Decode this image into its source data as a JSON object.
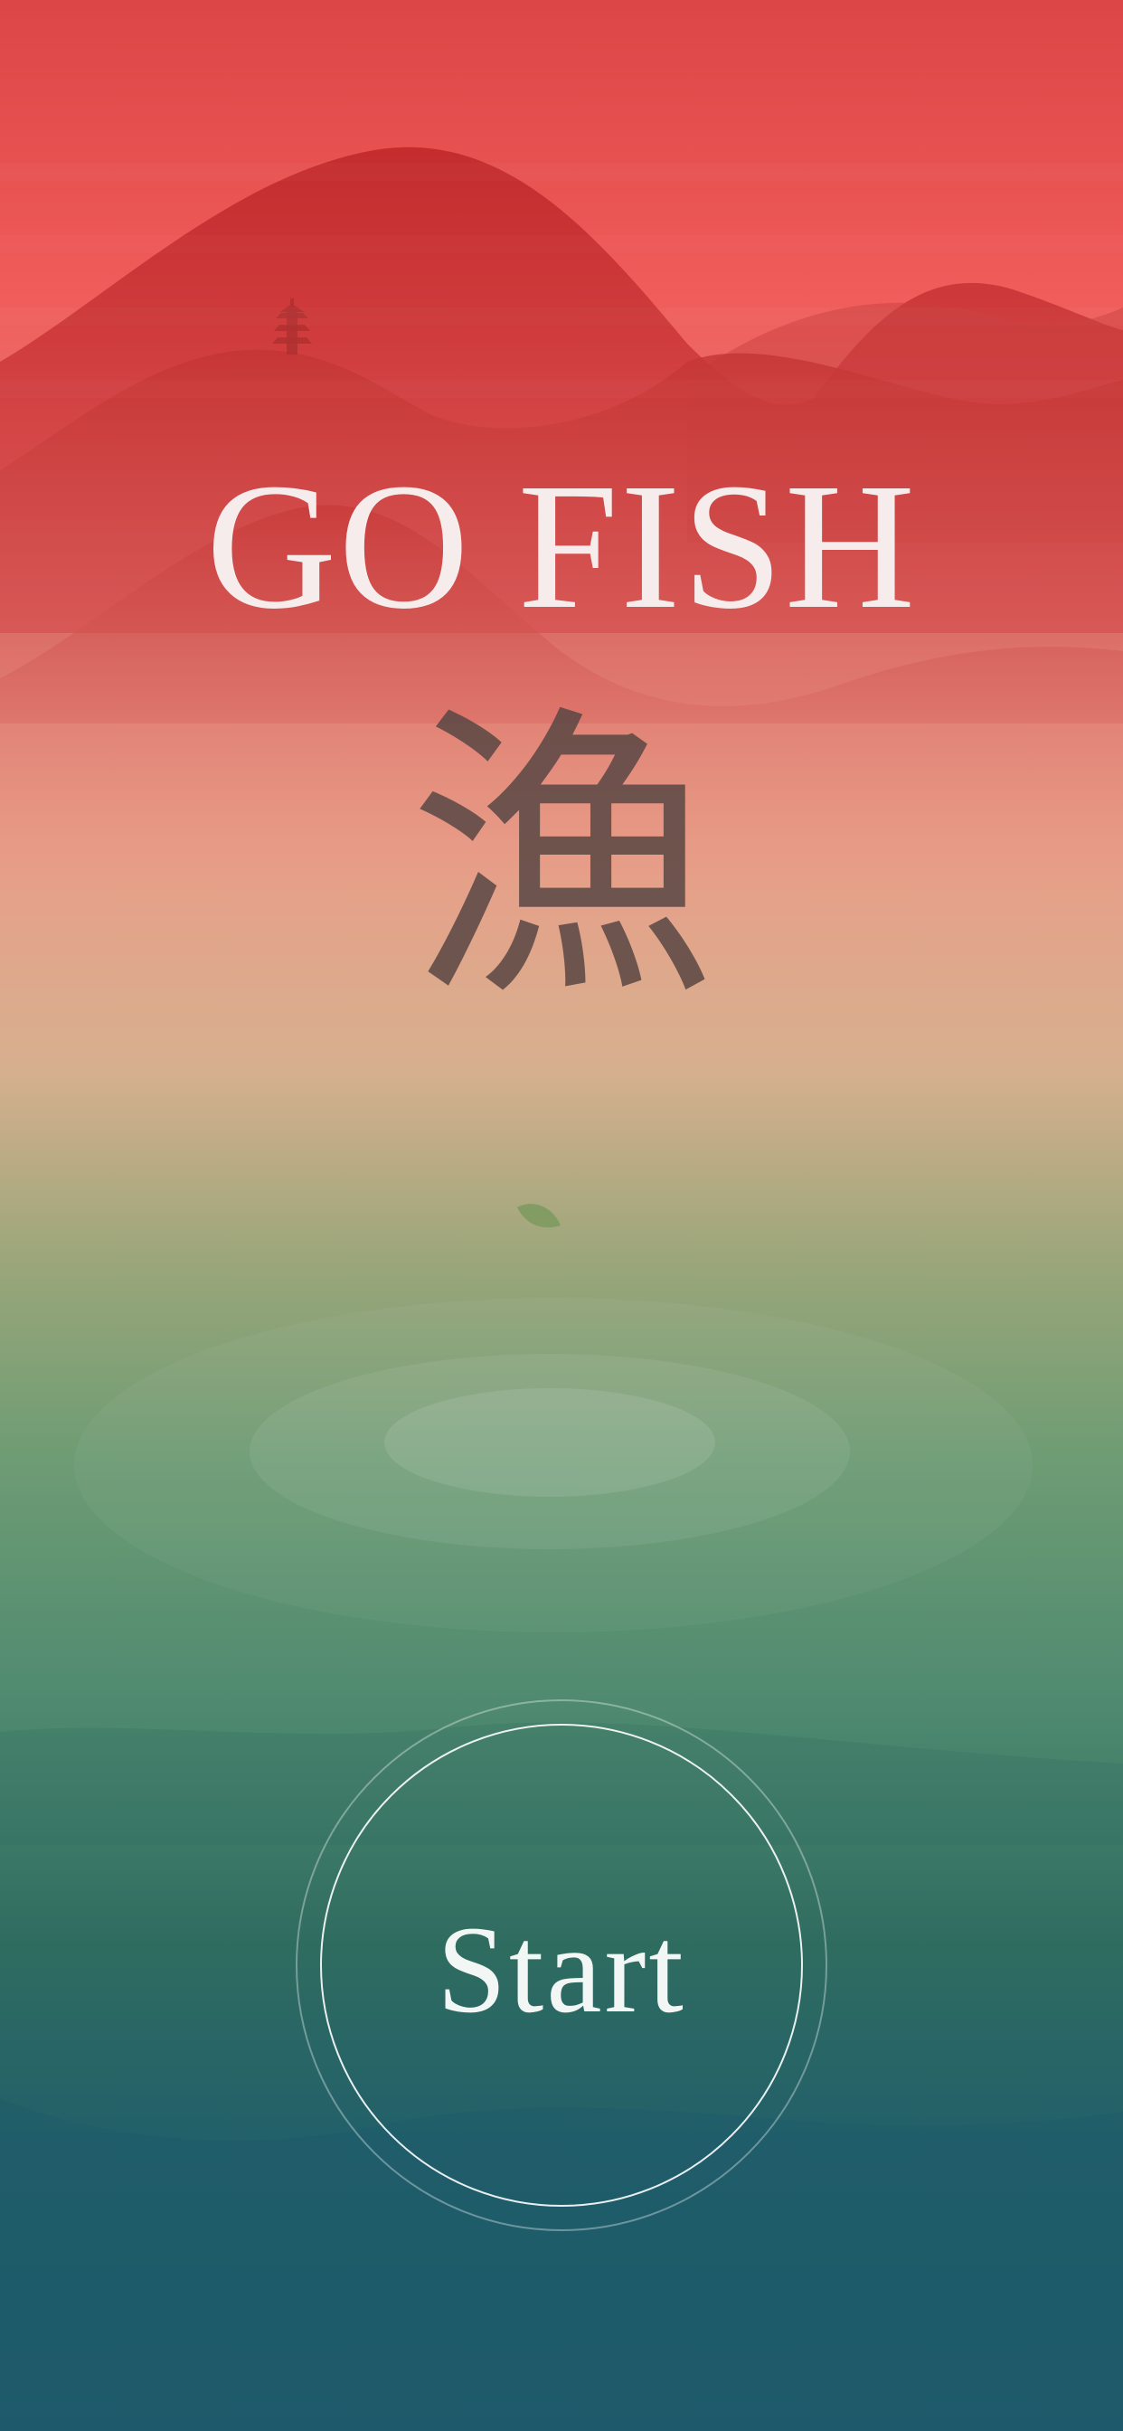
{
  "screen": {
    "title": "GO FISH",
    "glyph": "漁",
    "start_label": "Start"
  },
  "colors": {
    "sky_top": "#de4747",
    "sky_red": "#f2615a",
    "mid_peach": "#e6a08a",
    "mid_sand": "#c8b28e",
    "water_green": "#6c9c74",
    "deep_teal": "#2b6a62",
    "bottom_teal": "#1e5f6e",
    "title_color": "#f6ecec",
    "glyph_color": "#5a4744"
  },
  "icons": {
    "pagoda": "pagoda-icon",
    "leaf": "leaf-icon",
    "ripple": "ripple-rings"
  }
}
